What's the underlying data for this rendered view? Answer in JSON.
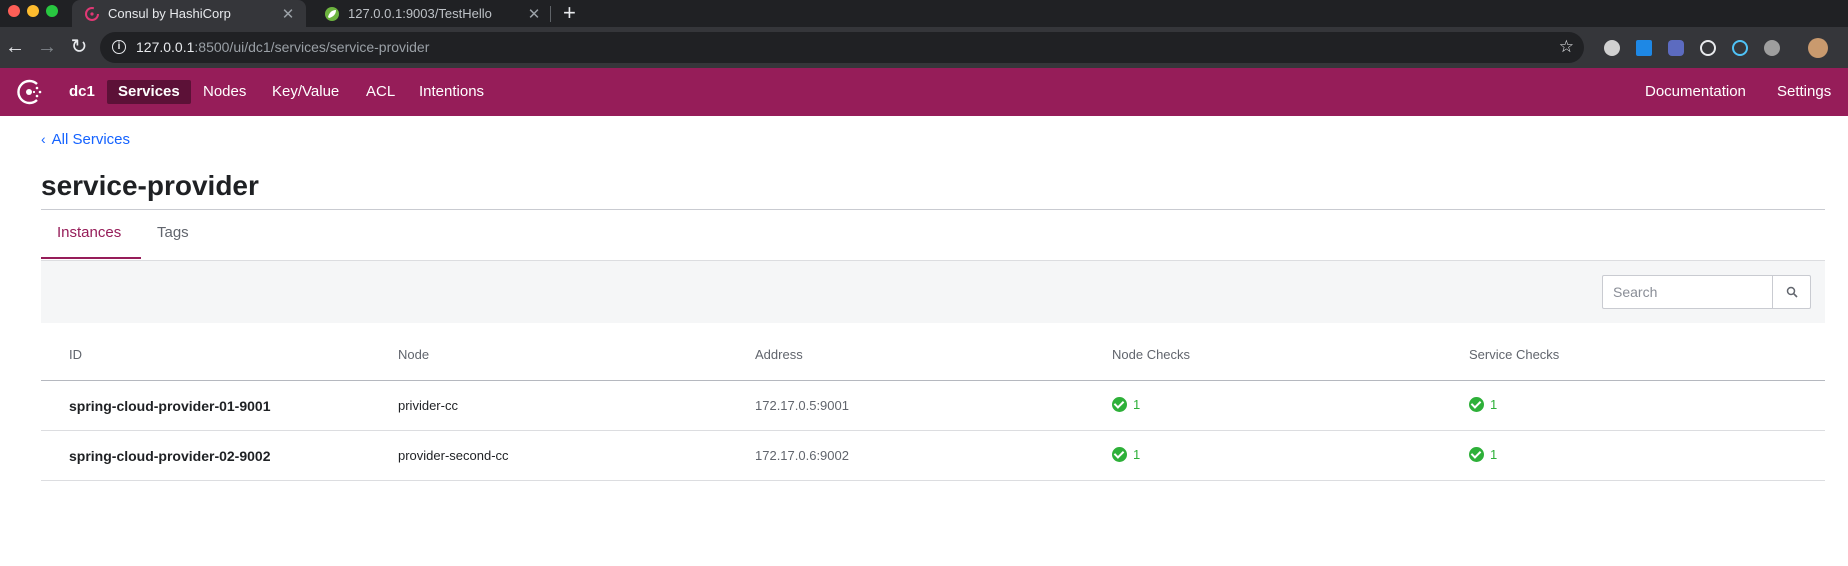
{
  "browser": {
    "tabs": [
      {
        "title": "Consul by HashiCorp",
        "icon": "consul-favicon-icon"
      },
      {
        "title": "127.0.0.1:9003/TestHello",
        "icon": "spring-leaf-icon"
      }
    ],
    "url_host": "127.0.0.1",
    "url_rest": ":8500/ui/dc1/services/service-provider"
  },
  "nav": {
    "datacenter": "dc1",
    "items": [
      "Services",
      "Nodes",
      "Key/Value",
      "ACL",
      "Intentions"
    ],
    "active": "Services",
    "right": [
      "Documentation",
      "Settings"
    ],
    "brand_color": "#961d59"
  },
  "breadcrumb": "All Services",
  "title": "service-provider",
  "tabs": [
    "Instances",
    "Tags"
  ],
  "active_tab": "Instances",
  "search": {
    "placeholder": "Search"
  },
  "table": {
    "headers": [
      "ID",
      "Node",
      "Address",
      "Node Checks",
      "Service Checks"
    ],
    "rows": [
      {
        "id": "spring-cloud-provider-01-9001",
        "node": "privider-cc",
        "address": "172.17.0.5:9001",
        "node_checks": "1",
        "service_checks": "1"
      },
      {
        "id": "spring-cloud-provider-02-9002",
        "node": "provider-second-cc",
        "address": "172.17.0.6:9002",
        "node_checks": "1",
        "service_checks": "1"
      }
    ]
  },
  "colors": {
    "passing": "#2eb039",
    "link": "#1563ff"
  }
}
